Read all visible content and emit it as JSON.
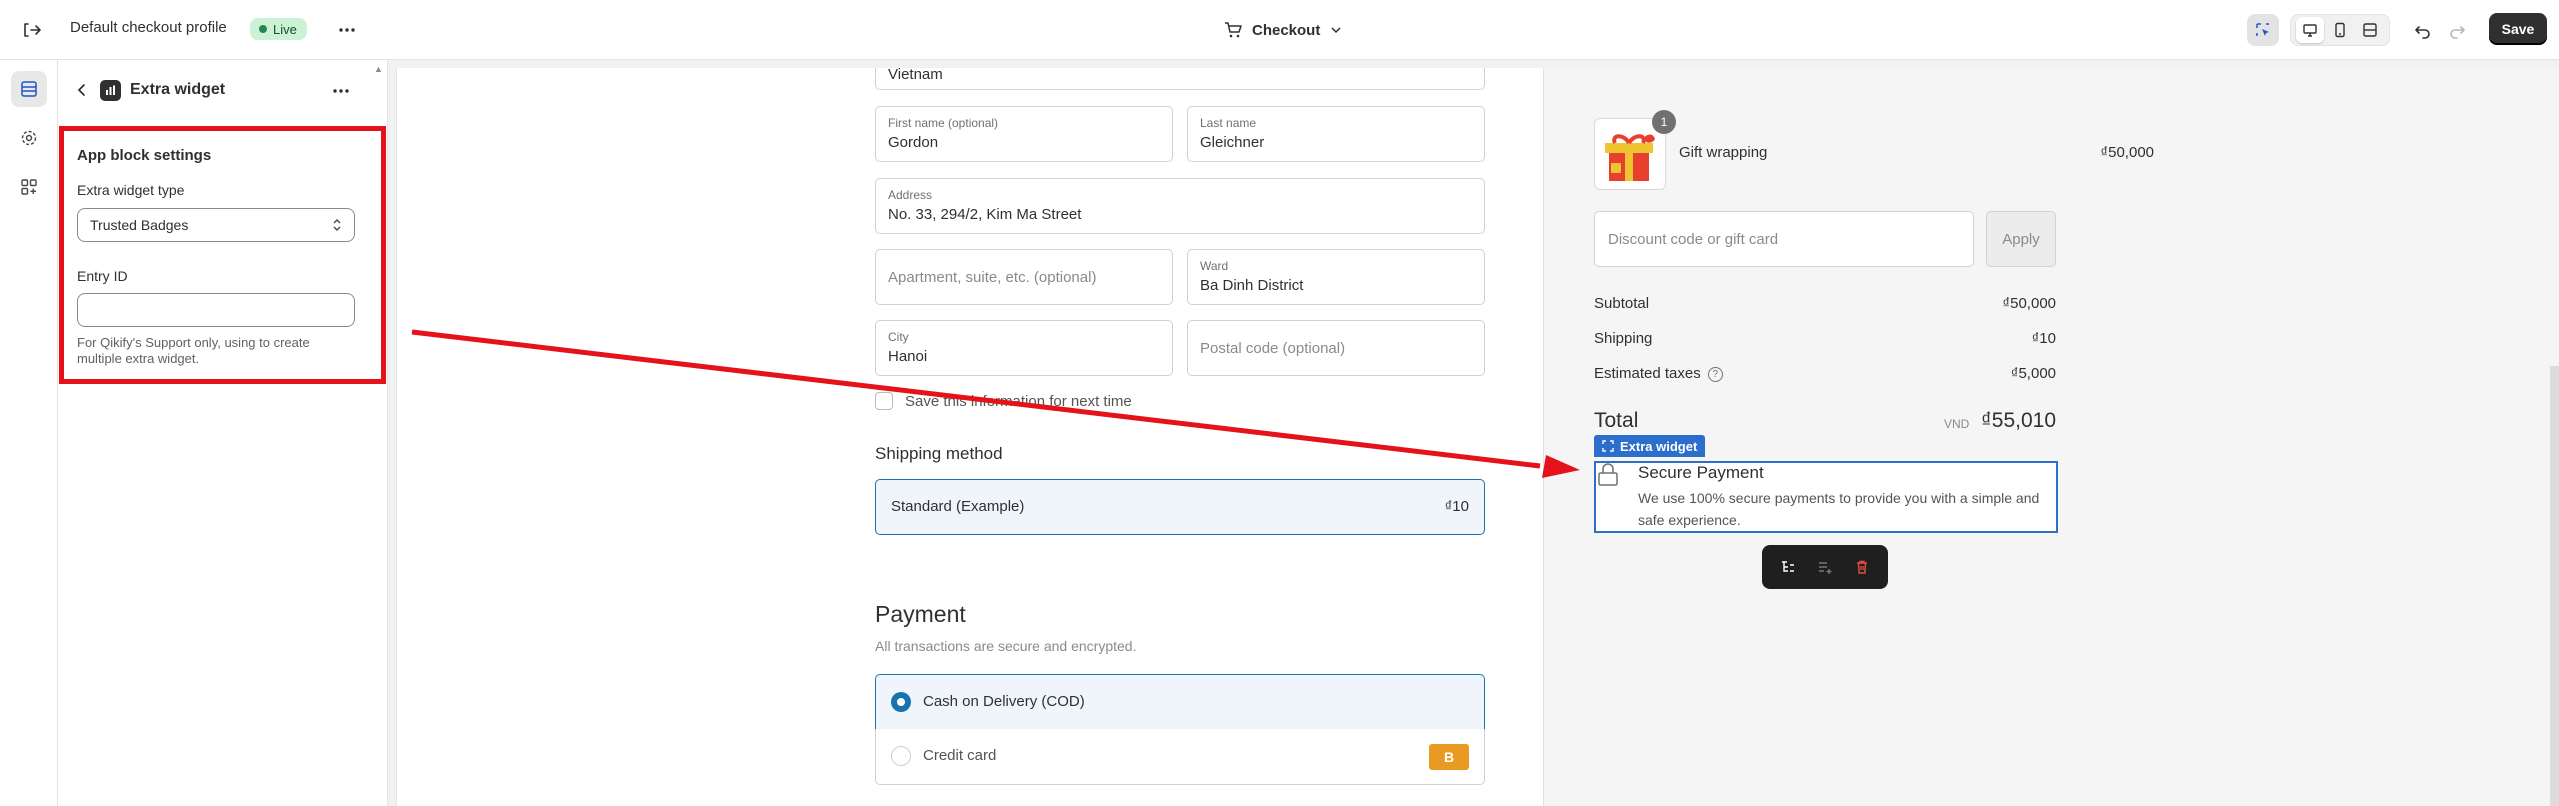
{
  "topbar": {
    "title": "Default checkout profile",
    "status": "Live",
    "page_selector": "Checkout",
    "save_label": "Save"
  },
  "rail": {
    "items": [
      {
        "icon": "sections-icon",
        "active": true
      },
      {
        "icon": "gear-icon",
        "active": false
      },
      {
        "icon": "apps-icon",
        "active": false
      }
    ]
  },
  "panel": {
    "title": "Extra widget",
    "settings_heading": "App block settings",
    "widget_type_label": "Extra widget type",
    "widget_type_value": "Trusted Badges",
    "entry_id_label": "Entry ID",
    "entry_id_value": "",
    "entry_id_help": "For Qikify's Support only, using to create multiple extra widget."
  },
  "form": {
    "country_value": "Vietnam",
    "first_name_label": "First name (optional)",
    "first_name_value": "Gordon",
    "last_name_label": "Last name",
    "last_name_value": "Gleichner",
    "address_label": "Address",
    "address_value": "No. 33, 294/2, Kim Ma Street",
    "apartment_placeholder": "Apartment, suite, etc. (optional)",
    "ward_label": "Ward",
    "ward_value": "Ba Dinh District",
    "city_label": "City",
    "city_value": "Hanoi",
    "postal_placeholder": "Postal code (optional)",
    "save_info_label": "Save this information for next time"
  },
  "shipping": {
    "title": "Shipping method",
    "option_name": "Standard (Example)",
    "option_price": "₫10"
  },
  "payment": {
    "title": "Payment",
    "subtitle": "All transactions are secure and encrypted.",
    "options": [
      {
        "label": "Cash on Delivery (COD)",
        "selected": true
      },
      {
        "label": "Credit card",
        "selected": false,
        "badge": "B"
      }
    ]
  },
  "summary": {
    "item_quantity": "1",
    "item_name": "Gift wrapping",
    "item_price": "₫50,000",
    "discount_placeholder": "Discount code or gift card",
    "apply_label": "Apply",
    "subtotal_label": "Subtotal",
    "subtotal_value": "₫50,000",
    "shipping_label": "Shipping",
    "shipping_value": "₫10",
    "taxes_label": "Estimated taxes",
    "taxes_value": "₫5,000",
    "total_label": "Total",
    "total_currency": "VND",
    "total_value": "₫55,010"
  },
  "extra_widget": {
    "tag_label": "Extra widget",
    "title": "Secure Payment",
    "description": "We use 100% secure payments to provide you with a simple and safe experience."
  },
  "colors": {
    "accent": "#2c6ecb",
    "annotation_red": "#e4121b",
    "checkout_blue": "#1773b0",
    "live_green": "#29845a"
  }
}
